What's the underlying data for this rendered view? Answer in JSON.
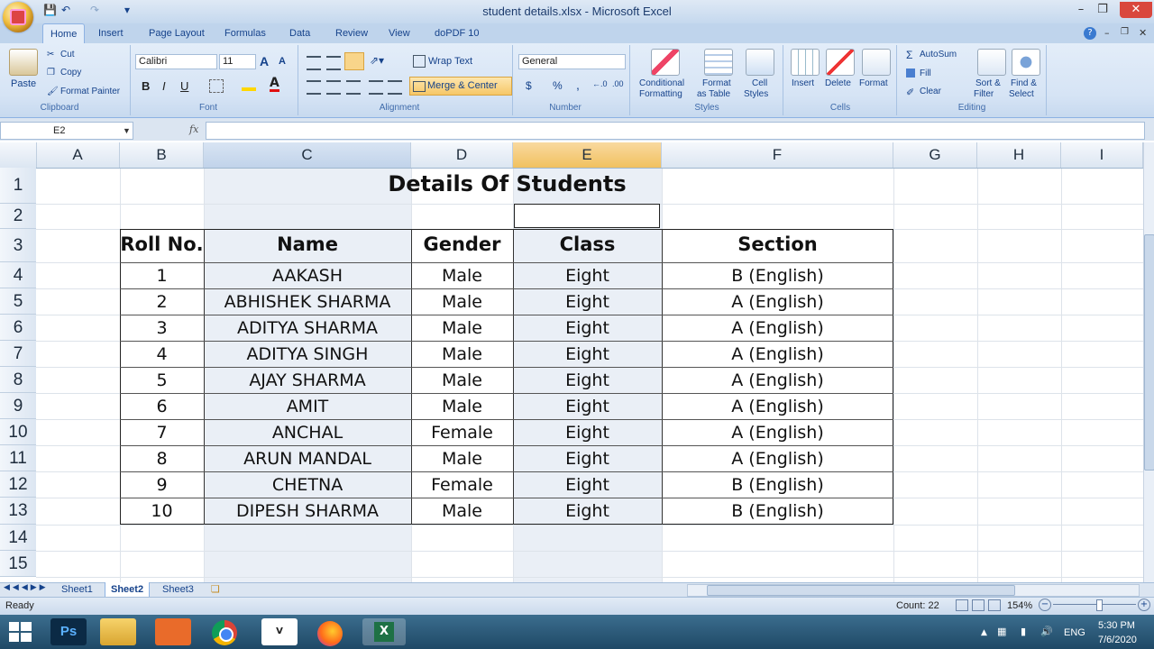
{
  "window": {
    "title": "student details.xlsx - Microsoft Excel",
    "minimize": "–",
    "maximize": "❐",
    "close": "✕",
    "doc_minimize": "–",
    "doc_restore": "❐",
    "doc_close": "✕",
    "help": "?"
  },
  "tabs": [
    "Home",
    "Insert",
    "Page Layout",
    "Formulas",
    "Data",
    "Review",
    "View",
    "doPDF 10"
  ],
  "ribbon": {
    "clipboard": {
      "label": "Clipboard",
      "paste": "Paste",
      "cut": "Cut",
      "copy": "Copy",
      "format_painter": "Format Painter"
    },
    "font": {
      "label": "Font",
      "name": "Calibri",
      "size": "11",
      "bold": "B",
      "italic": "I",
      "underline": "U",
      "grow": "A",
      "shrink": "A"
    },
    "alignment": {
      "label": "Alignment",
      "wrap_text": "Wrap Text",
      "merge_center": "Merge & Center"
    },
    "number": {
      "label": "Number",
      "format": "General",
      "currency": "$",
      "percent": "%",
      "comma": ","
    },
    "styles": {
      "label": "Styles",
      "conditional_1": "Conditional",
      "conditional_2": "Formatting",
      "format_table_1": "Format",
      "format_table_2": "as Table",
      "cell_styles_1": "Cell",
      "cell_styles_2": "Styles"
    },
    "cells": {
      "label": "Cells",
      "insert": "Insert",
      "delete": "Delete",
      "format": "Format"
    },
    "editing": {
      "label": "Editing",
      "autosum": "AutoSum",
      "fill": "Fill",
      "clear": "Clear",
      "sort_1": "Sort &",
      "sort_2": "Filter",
      "find_1": "Find &",
      "find_2": "Select"
    }
  },
  "formula_bar": {
    "name_box": "E2",
    "fx": "fx",
    "value": ""
  },
  "columns": [
    "A",
    "B",
    "C",
    "D",
    "E",
    "F",
    "G",
    "H",
    "I"
  ],
  "rows": [
    "1",
    "2",
    "3",
    "4",
    "5",
    "6",
    "7",
    "8",
    "9",
    "10",
    "11",
    "12",
    "13",
    "14",
    "15"
  ],
  "sheet": {
    "title": "Details Of Students",
    "headers": [
      "Roll No.",
      "Name",
      "Gender",
      "Class",
      "Section"
    ],
    "records": [
      [
        "1",
        "AAKASH",
        "Male",
        "Eight",
        "B (English)"
      ],
      [
        "2",
        "ABHISHEK SHARMA",
        "Male",
        "Eight",
        "A (English)"
      ],
      [
        "3",
        "ADITYA SHARMA",
        "Male",
        "Eight",
        "A (English)"
      ],
      [
        "4",
        "ADITYA SINGH",
        "Male",
        "Eight",
        "A (English)"
      ],
      [
        "5",
        "AJAY SHARMA",
        "Male",
        "Eight",
        "A (English)"
      ],
      [
        "6",
        "AMIT",
        "Male",
        "Eight",
        "A (English)"
      ],
      [
        "7",
        "ANCHAL",
        "Female",
        "Eight",
        "A (English)"
      ],
      [
        "8",
        "ARUN MANDAL",
        "Male",
        "Eight",
        "A (English)"
      ],
      [
        "9",
        "CHETNA",
        "Female",
        "Eight",
        "B (English)"
      ],
      [
        "10",
        "DIPESH SHARMA",
        "Male",
        "Eight",
        "B (English)"
      ]
    ]
  },
  "sheet_tabs": [
    "Sheet1",
    "Sheet2",
    "Sheet3"
  ],
  "active_sheet": "Sheet2",
  "status": {
    "ready": "Ready",
    "count": "Count: 22",
    "zoom": "154%"
  },
  "taskbar": {
    "language": "ENG",
    "time": "5:30 PM",
    "date": "7/6/2020"
  },
  "colors": {
    "accent": "#15428b",
    "selected_header": "#f1c15f",
    "column_shade": "#eaeff6"
  }
}
